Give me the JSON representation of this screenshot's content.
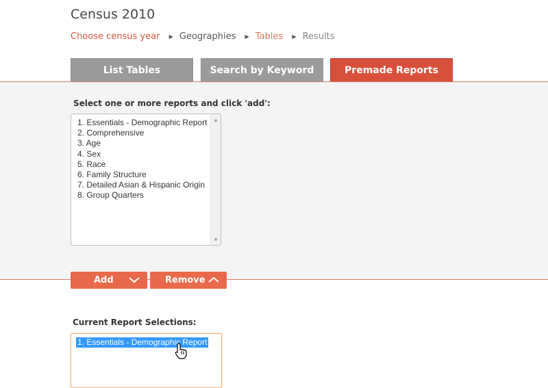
{
  "page": {
    "title": "Census 2010"
  },
  "breadcrumb": [
    {
      "label": "Choose census year",
      "state": "active"
    },
    {
      "label": "Geographies",
      "state": "normal"
    },
    {
      "label": "Tables",
      "state": "link"
    },
    {
      "label": "Results",
      "state": "muted"
    }
  ],
  "tabs": [
    {
      "label": "List Tables",
      "selected": false
    },
    {
      "label": "Search by Keyword",
      "selected": false
    },
    {
      "label": "Premade Reports",
      "selected": true
    }
  ],
  "reports": {
    "prompt": "Select one or more reports and click 'add':",
    "items": [
      "1. Essentials - Demographic Report",
      "2. Comprehensive",
      "3. Age",
      "4. Sex",
      "5. Race",
      "6. Family Structure",
      "7. Detailed Asian & Hispanic Origin",
      "8. Group Quarters"
    ]
  },
  "actions": {
    "add_label": "Add",
    "add_icon": "chevron-down-icon",
    "remove_label": "Remove",
    "remove_icon": "chevron-up-icon"
  },
  "selections": {
    "label": "Current Report Selections:",
    "items": [
      "1. Essentials - Demographic Report"
    ],
    "highlighted_index": 0
  },
  "colors": {
    "accent": "#d9503a",
    "button": "#e8694b",
    "tab_inactive": "#9b9b9b",
    "panel_bg": "#f4f4f4",
    "selection_highlight": "#3399ff"
  }
}
